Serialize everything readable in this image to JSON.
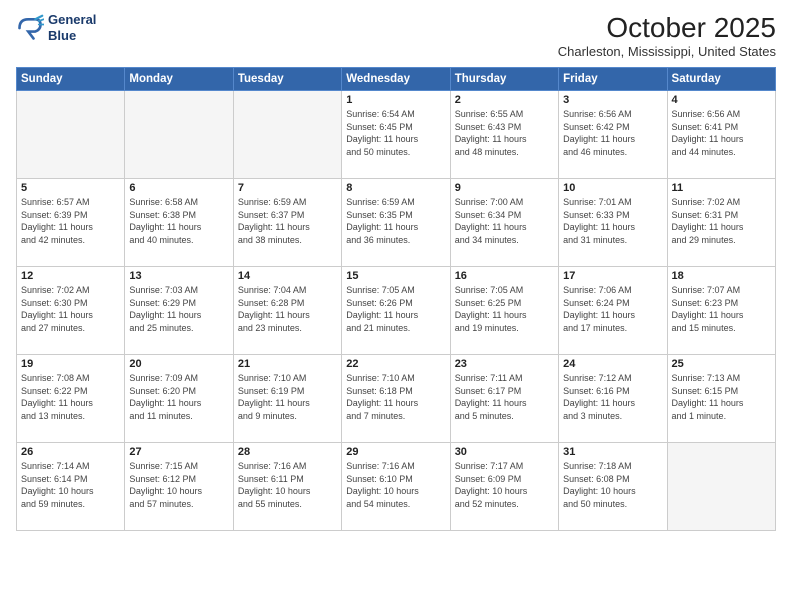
{
  "logo": {
    "line1": "General",
    "line2": "Blue"
  },
  "title": "October 2025",
  "subtitle": "Charleston, Mississippi, United States",
  "headers": [
    "Sunday",
    "Monday",
    "Tuesday",
    "Wednesday",
    "Thursday",
    "Friday",
    "Saturday"
  ],
  "weeks": [
    [
      {
        "day": "",
        "info": ""
      },
      {
        "day": "",
        "info": ""
      },
      {
        "day": "",
        "info": ""
      },
      {
        "day": "1",
        "info": "Sunrise: 6:54 AM\nSunset: 6:45 PM\nDaylight: 11 hours\nand 50 minutes."
      },
      {
        "day": "2",
        "info": "Sunrise: 6:55 AM\nSunset: 6:43 PM\nDaylight: 11 hours\nand 48 minutes."
      },
      {
        "day": "3",
        "info": "Sunrise: 6:56 AM\nSunset: 6:42 PM\nDaylight: 11 hours\nand 46 minutes."
      },
      {
        "day": "4",
        "info": "Sunrise: 6:56 AM\nSunset: 6:41 PM\nDaylight: 11 hours\nand 44 minutes."
      }
    ],
    [
      {
        "day": "5",
        "info": "Sunrise: 6:57 AM\nSunset: 6:39 PM\nDaylight: 11 hours\nand 42 minutes."
      },
      {
        "day": "6",
        "info": "Sunrise: 6:58 AM\nSunset: 6:38 PM\nDaylight: 11 hours\nand 40 minutes."
      },
      {
        "day": "7",
        "info": "Sunrise: 6:59 AM\nSunset: 6:37 PM\nDaylight: 11 hours\nand 38 minutes."
      },
      {
        "day": "8",
        "info": "Sunrise: 6:59 AM\nSunset: 6:35 PM\nDaylight: 11 hours\nand 36 minutes."
      },
      {
        "day": "9",
        "info": "Sunrise: 7:00 AM\nSunset: 6:34 PM\nDaylight: 11 hours\nand 34 minutes."
      },
      {
        "day": "10",
        "info": "Sunrise: 7:01 AM\nSunset: 6:33 PM\nDaylight: 11 hours\nand 31 minutes."
      },
      {
        "day": "11",
        "info": "Sunrise: 7:02 AM\nSunset: 6:31 PM\nDaylight: 11 hours\nand 29 minutes."
      }
    ],
    [
      {
        "day": "12",
        "info": "Sunrise: 7:02 AM\nSunset: 6:30 PM\nDaylight: 11 hours\nand 27 minutes."
      },
      {
        "day": "13",
        "info": "Sunrise: 7:03 AM\nSunset: 6:29 PM\nDaylight: 11 hours\nand 25 minutes."
      },
      {
        "day": "14",
        "info": "Sunrise: 7:04 AM\nSunset: 6:28 PM\nDaylight: 11 hours\nand 23 minutes."
      },
      {
        "day": "15",
        "info": "Sunrise: 7:05 AM\nSunset: 6:26 PM\nDaylight: 11 hours\nand 21 minutes."
      },
      {
        "day": "16",
        "info": "Sunrise: 7:05 AM\nSunset: 6:25 PM\nDaylight: 11 hours\nand 19 minutes."
      },
      {
        "day": "17",
        "info": "Sunrise: 7:06 AM\nSunset: 6:24 PM\nDaylight: 11 hours\nand 17 minutes."
      },
      {
        "day": "18",
        "info": "Sunrise: 7:07 AM\nSunset: 6:23 PM\nDaylight: 11 hours\nand 15 minutes."
      }
    ],
    [
      {
        "day": "19",
        "info": "Sunrise: 7:08 AM\nSunset: 6:22 PM\nDaylight: 11 hours\nand 13 minutes."
      },
      {
        "day": "20",
        "info": "Sunrise: 7:09 AM\nSunset: 6:20 PM\nDaylight: 11 hours\nand 11 minutes."
      },
      {
        "day": "21",
        "info": "Sunrise: 7:10 AM\nSunset: 6:19 PM\nDaylight: 11 hours\nand 9 minutes."
      },
      {
        "day": "22",
        "info": "Sunrise: 7:10 AM\nSunset: 6:18 PM\nDaylight: 11 hours\nand 7 minutes."
      },
      {
        "day": "23",
        "info": "Sunrise: 7:11 AM\nSunset: 6:17 PM\nDaylight: 11 hours\nand 5 minutes."
      },
      {
        "day": "24",
        "info": "Sunrise: 7:12 AM\nSunset: 6:16 PM\nDaylight: 11 hours\nand 3 minutes."
      },
      {
        "day": "25",
        "info": "Sunrise: 7:13 AM\nSunset: 6:15 PM\nDaylight: 11 hours\nand 1 minute."
      }
    ],
    [
      {
        "day": "26",
        "info": "Sunrise: 7:14 AM\nSunset: 6:14 PM\nDaylight: 10 hours\nand 59 minutes."
      },
      {
        "day": "27",
        "info": "Sunrise: 7:15 AM\nSunset: 6:12 PM\nDaylight: 10 hours\nand 57 minutes."
      },
      {
        "day": "28",
        "info": "Sunrise: 7:16 AM\nSunset: 6:11 PM\nDaylight: 10 hours\nand 55 minutes."
      },
      {
        "day": "29",
        "info": "Sunrise: 7:16 AM\nSunset: 6:10 PM\nDaylight: 10 hours\nand 54 minutes."
      },
      {
        "day": "30",
        "info": "Sunrise: 7:17 AM\nSunset: 6:09 PM\nDaylight: 10 hours\nand 52 minutes."
      },
      {
        "day": "31",
        "info": "Sunrise: 7:18 AM\nSunset: 6:08 PM\nDaylight: 10 hours\nand 50 minutes."
      },
      {
        "day": "",
        "info": ""
      }
    ]
  ]
}
